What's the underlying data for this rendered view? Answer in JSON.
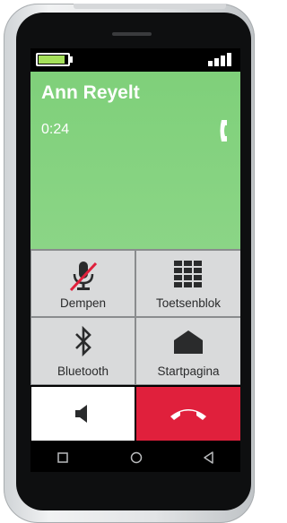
{
  "call": {
    "caller_name": "Ann Reyelt",
    "duration": "0:24",
    "battery_level": 0.95,
    "signal_bars": 4
  },
  "controls": {
    "mute_label": "Dempen",
    "keypad_label": "Toetsenblok",
    "bluetooth_label": "Bluetooth",
    "home_label": "Startpagina"
  },
  "colors": {
    "caller_panel": "#7fd07a",
    "hangup": "#e0203c",
    "mute_slash": "#e0203c",
    "battery_fill": "#a5e05a"
  },
  "icons": {
    "mute": "microphone-muted-icon",
    "keypad": "keypad-grid-icon",
    "bluetooth": "bluetooth-icon",
    "home": "home-icon",
    "speaker": "speaker-icon",
    "hangup": "hangup-phone-icon",
    "handset": "handset-icon",
    "nav_recent": "square-icon",
    "nav_home": "circle-icon",
    "nav_back": "triangle-back-icon"
  }
}
